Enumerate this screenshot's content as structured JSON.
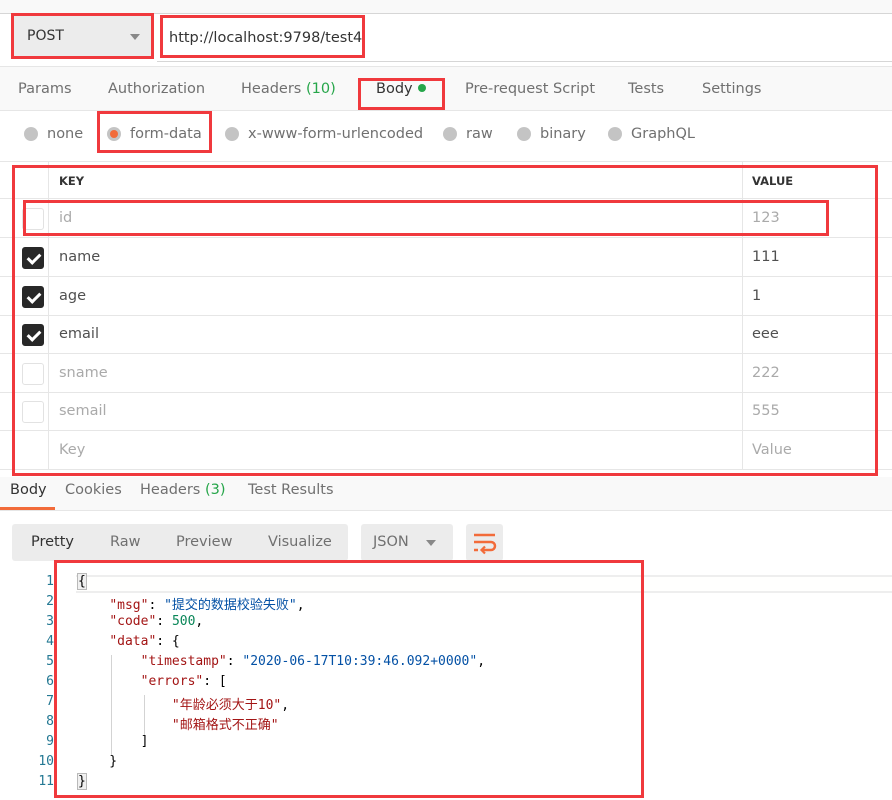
{
  "request": {
    "method": "POST",
    "url": "http://localhost:9798/test4"
  },
  "request_tabs": [
    {
      "label": "Params"
    },
    {
      "label": "Authorization"
    },
    {
      "label": "Headers",
      "count": "(10)"
    },
    {
      "label": "Body",
      "active": true,
      "indicator": "green-dot"
    },
    {
      "label": "Pre-request Script"
    },
    {
      "label": "Tests"
    },
    {
      "label": "Settings"
    }
  ],
  "body_types": [
    {
      "label": "none",
      "selected": false
    },
    {
      "label": "form-data",
      "selected": true
    },
    {
      "label": "x-www-form-urlencoded",
      "selected": false
    },
    {
      "label": "raw",
      "selected": false
    },
    {
      "label": "binary",
      "selected": false
    },
    {
      "label": "GraphQL",
      "selected": false
    }
  ],
  "form_table": {
    "headers": {
      "key": "KEY",
      "value": "VALUE"
    },
    "rows": [
      {
        "key": "id",
        "value": "123",
        "checked": false
      },
      {
        "key": "name",
        "value": "111",
        "checked": true
      },
      {
        "key": "age",
        "value": "1",
        "checked": true
      },
      {
        "key": "email",
        "value": "eee",
        "checked": true
      },
      {
        "key": "sname",
        "value": "222",
        "checked": false
      },
      {
        "key": "semail",
        "value": "555",
        "checked": false
      }
    ],
    "new_row": {
      "key_placeholder": "Key",
      "value_placeholder": "Value"
    }
  },
  "response_tabs": [
    {
      "label": "Body",
      "active": true
    },
    {
      "label": "Cookies"
    },
    {
      "label": "Headers",
      "count": "(3)"
    },
    {
      "label": "Test Results"
    }
  ],
  "view_modes": [
    {
      "label": "Pretty",
      "active": true
    },
    {
      "label": "Raw"
    },
    {
      "label": "Preview"
    },
    {
      "label": "Visualize"
    }
  ],
  "format": {
    "selected": "JSON"
  },
  "icons": {
    "wrap": "wrap-lines-icon",
    "method_dropdown": "chevron-down-icon",
    "format_dropdown": "chevron-down-icon"
  },
  "response_body": {
    "line_numbers": [
      "1",
      "2",
      "3",
      "4",
      "5",
      "6",
      "7",
      "8",
      "9",
      "10",
      "11"
    ],
    "msg_key": "\"msg\"",
    "msg_value": "\"提交的数据校验失败\"",
    "code_key": "\"code\"",
    "code_value": "500",
    "data_key": "\"data\"",
    "timestamp_key": "\"timestamp\"",
    "timestamp_value": "\"2020-06-17T10:39:46.092+0000\"",
    "errors_key": "\"errors\"",
    "errors": [
      "\"年龄必须大于10\"",
      "\"邮箱格式不正确\""
    ]
  },
  "colors": {
    "accent": "#f26b3a",
    "success": "#26a64a",
    "annotation": "#f0393d"
  }
}
